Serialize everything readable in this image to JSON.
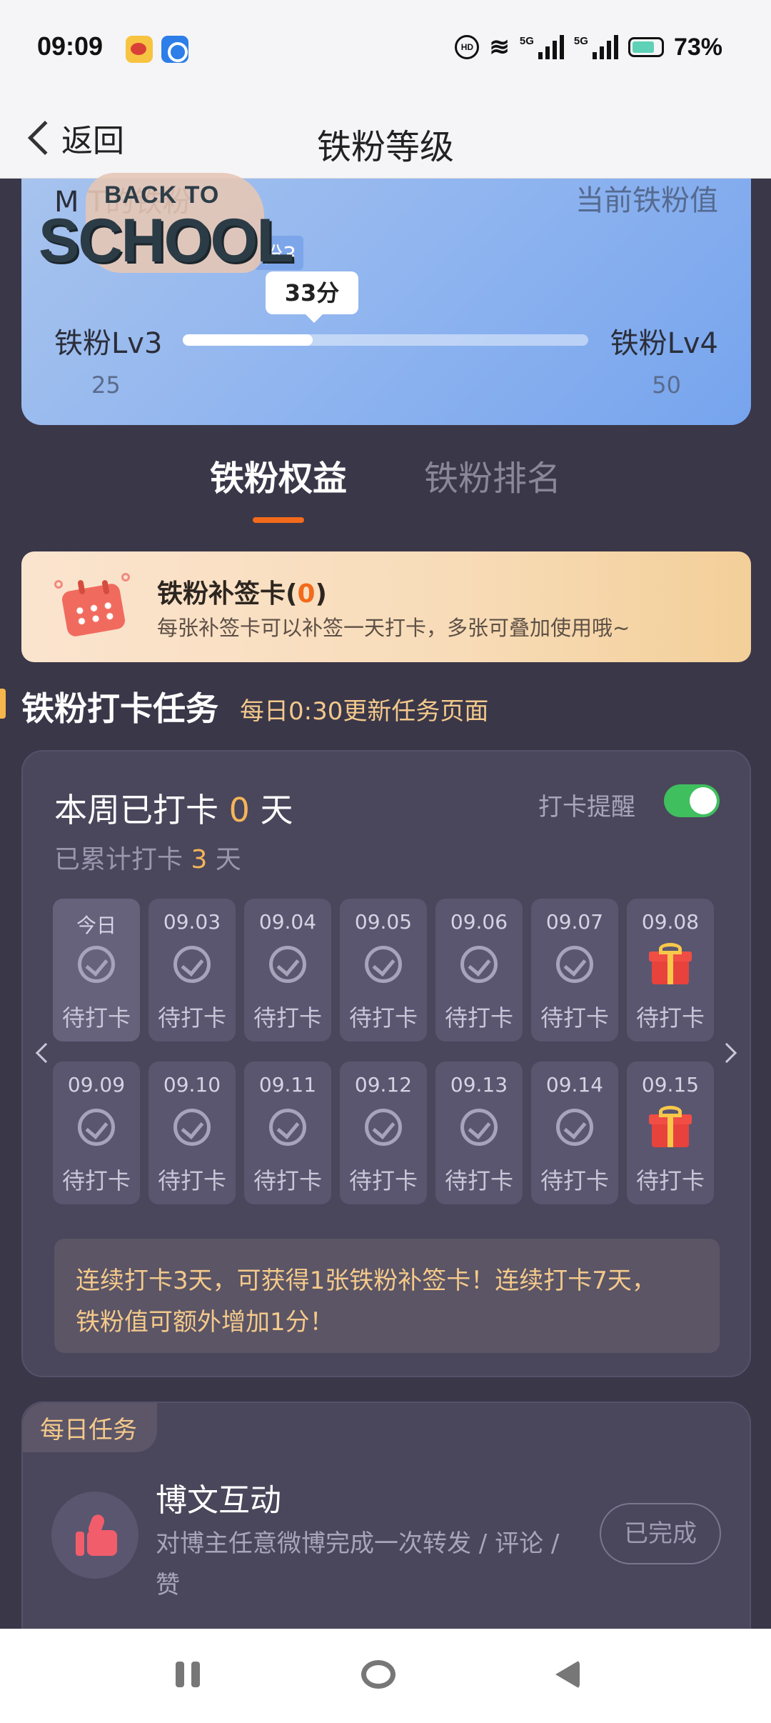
{
  "status_bar": {
    "time": "09:09",
    "battery": "73%",
    "network_1": "5G",
    "network_2": "5G",
    "hd_badge": "HD",
    "app_icons": [
      "weibo-icon",
      "app-icon"
    ]
  },
  "header": {
    "back_label": "返回",
    "title": "铁粉等级"
  },
  "level_card": {
    "user_name": "M          T的铁粉",
    "current_value_label": "当前铁粉值",
    "level_chip": "粉3",
    "score": "33分",
    "current_level": "铁粉Lv3",
    "next_level": "铁粉Lv4",
    "current_level_min": "25",
    "next_level_min": "50",
    "progress_fraction": 0.32,
    "sticker_top": "BACK TO",
    "sticker_main": "SCHOOL"
  },
  "tabs": [
    {
      "label": "铁粉权益",
      "active": true
    },
    {
      "label": "铁粉排名",
      "active": false
    }
  ],
  "makeup_card": {
    "title_prefix": "铁粉补签卡(",
    "count": "0",
    "title_suffix": ")",
    "description": "每张补签卡可以补签一天打卡，多张可叠加使用哦~"
  },
  "checkin_section": {
    "title": "铁粉打卡任务",
    "subtitle": "每日0:30更新任务页面"
  },
  "checkin_card": {
    "week_prefix": "本周已打卡 ",
    "week_count": "0",
    "week_suffix": " 天",
    "total_prefix": "已累计打卡 ",
    "total_count": "3",
    "total_suffix": " 天",
    "reminder_label": "打卡提醒",
    "reminder_on": true,
    "days": [
      {
        "date": "今日",
        "status": "待打卡",
        "gift": false,
        "today": true
      },
      {
        "date": "09.03",
        "status": "待打卡",
        "gift": false
      },
      {
        "date": "09.04",
        "status": "待打卡",
        "gift": false
      },
      {
        "date": "09.05",
        "status": "待打卡",
        "gift": false
      },
      {
        "date": "09.06",
        "status": "待打卡",
        "gift": false
      },
      {
        "date": "09.07",
        "status": "待打卡",
        "gift": false
      },
      {
        "date": "09.08",
        "status": "待打卡",
        "gift": true
      },
      {
        "date": "09.09",
        "status": "待打卡",
        "gift": false
      },
      {
        "date": "09.10",
        "status": "待打卡",
        "gift": false
      },
      {
        "date": "09.11",
        "status": "待打卡",
        "gift": false
      },
      {
        "date": "09.12",
        "status": "待打卡",
        "gift": false
      },
      {
        "date": "09.13",
        "status": "待打卡",
        "gift": false
      },
      {
        "date": "09.14",
        "status": "待打卡",
        "gift": false
      },
      {
        "date": "09.15",
        "status": "待打卡",
        "gift": true
      }
    ],
    "bonus_line_1": "连续打卡3天，可获得1张铁粉补签卡！连续打卡7天，",
    "bonus_line_2": "铁粉值可额外增加1分！"
  },
  "daily_tasks": {
    "tag": "每日任务",
    "tasks": [
      {
        "title": "博文互动",
        "description": "对博主任意微博完成一次转发 / 评论 / 赞",
        "button": "已完成",
        "icon": "thumbs-up-icon"
      }
    ]
  },
  "colors": {
    "background": "#3a3749",
    "accent_orange": "#f26a1b",
    "highlight_gold": "#f4b55a",
    "toggle_green": "#3fbf5e"
  }
}
